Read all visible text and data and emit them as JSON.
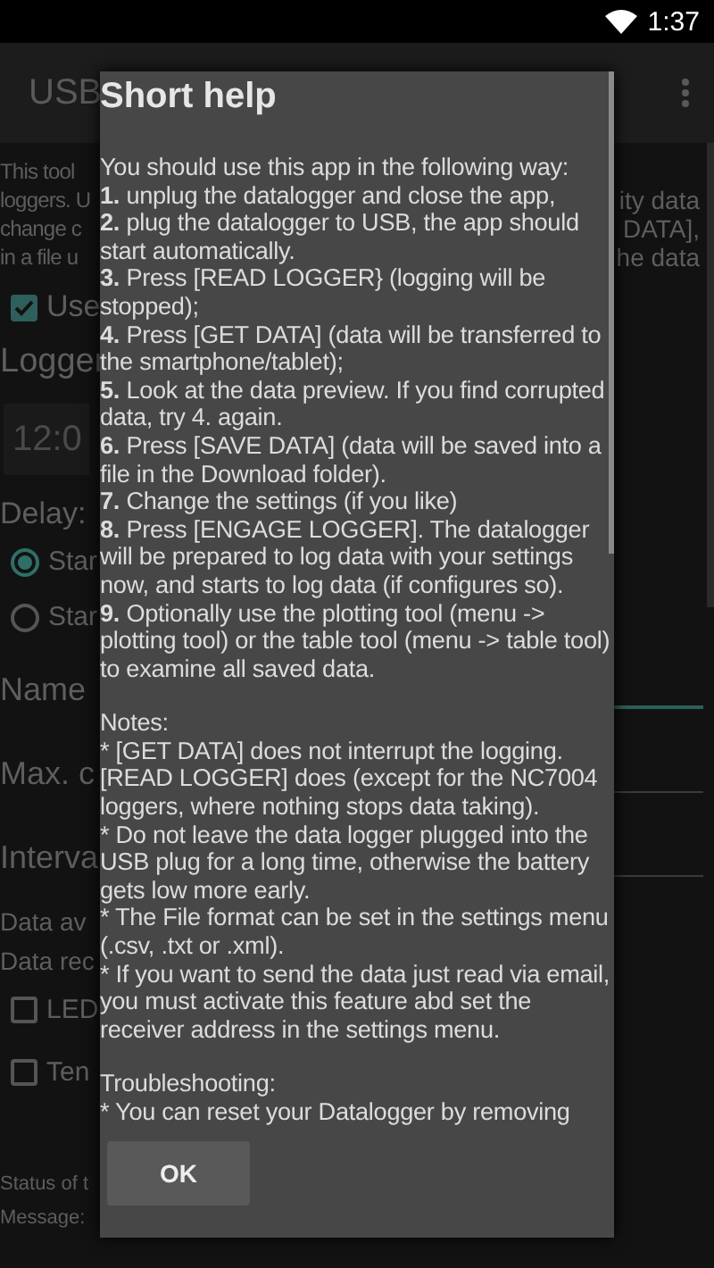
{
  "status_bar": {
    "time": "1:37"
  },
  "app_bar": {
    "title": "USB"
  },
  "background": {
    "description_left": [
      "This tool",
      "loggers. U",
      "change c",
      "in a file u"
    ],
    "description_right": [
      "ity data",
      "DATA],",
      "he data"
    ],
    "use_checkbox": {
      "label": "Use",
      "checked": true
    },
    "logger_label": "Logger",
    "time_field": {
      "value": "12:0"
    },
    "delay_label": "Delay:",
    "radios": [
      {
        "label": "Star",
        "selected": true
      },
      {
        "label": "Star",
        "selected": false
      }
    ],
    "fields": [
      {
        "label": "Name",
        "focused": true
      },
      {
        "label": "Max. c",
        "focused": false
      },
      {
        "label": "Interva",
        "focused": false
      }
    ],
    "data_lines": [
      "Data av",
      "Data rec"
    ],
    "checkboxes": [
      {
        "label": "LED",
        "checked": false
      },
      {
        "label": "Ten",
        "checked": false
      }
    ],
    "status_lines": [
      "Status of t",
      "Message:"
    ]
  },
  "dialog": {
    "title": "Short help",
    "intro": "You should use this app in the following way:",
    "steps": [
      {
        "number": "1.",
        "text": "unplug the datalogger and close the app,"
      },
      {
        "number": "2.",
        "text": "plug the datalogger to USB, the app should start automatically."
      },
      {
        "number": "3.",
        "text": "Press [READ LOGGER} (logging will be stopped);"
      },
      {
        "number": "4.",
        "text": "Press [GET DATA] (data will be transferred to the smartphone/tablet);"
      },
      {
        "number": "5.",
        "text": "Look at the data preview. If you find corrupted data, try 4. again."
      },
      {
        "number": "6.",
        "text": "Press [SAVE DATA] (data will be saved into a file in the Download folder)."
      },
      {
        "number": "7.",
        "text": "Change the settings (if you like)"
      },
      {
        "number": "8.",
        "text": "Press [ENGAGE LOGGER]. The datalogger will be prepared to log data with your settings now, and starts to log data (if configures so)."
      },
      {
        "number": "9.",
        "text": "Optionally use the plotting tool (menu -> plotting tool) or the table tool (menu -> table tool) to examine all saved data."
      }
    ],
    "notes_heading": "Notes:",
    "notes": [
      "* [GET DATA] does not interrupt the logging. [READ LOGGER] does (except for the NC7004 loggers, where nothing stops data taking).",
      "* Do not leave the data logger plugged into the USB plug for a long time, otherwise the battery gets low more early.",
      "* The File format can be set in the settings menu (.csv, .txt or .xml).",
      "* If you want to send the data just read via email, you must activate this feature abd set the receiver address in the settings menu."
    ],
    "troubleshooting_heading": "Troubleshooting:",
    "troubleshooting": [
      "* You can reset your Datalogger by removing"
    ],
    "button": "OK"
  }
}
